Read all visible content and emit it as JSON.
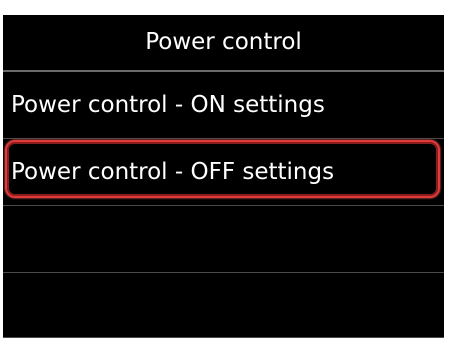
{
  "header": {
    "title": "Power control"
  },
  "menu": {
    "items": [
      {
        "label": "Power control - ON settings",
        "selected": false
      },
      {
        "label": "Power control - OFF settings",
        "selected": true
      },
      {
        "label": "",
        "selected": false
      },
      {
        "label": "",
        "selected": false
      }
    ]
  },
  "colors": {
    "background": "#000000",
    "text": "#ffffff",
    "selection_outline": "#e23a3a"
  }
}
